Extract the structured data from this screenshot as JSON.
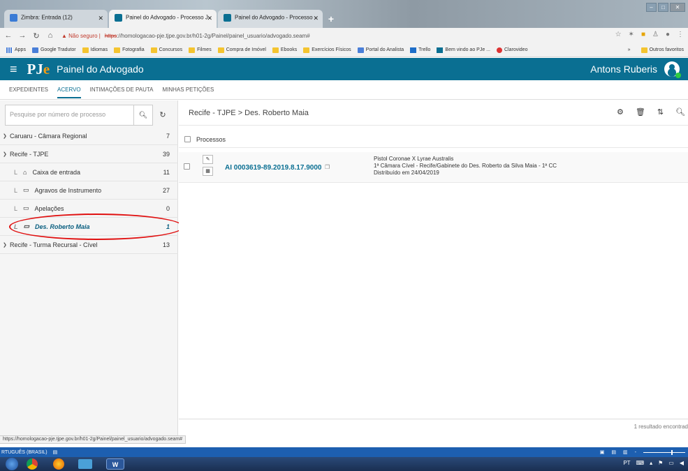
{
  "browser": {
    "tabs": [
      {
        "label": "Zimbra: Entrada (12)",
        "favicon_color": "#3a7bd5"
      },
      {
        "label": "Painel do Advogado - Processo J",
        "favicon_color": "#0a6f92"
      },
      {
        "label": "Painel do Advogado - Processo",
        "favicon_color": "#0a6f92"
      }
    ],
    "insecure_label": "Não seguro",
    "url_scheme": "https",
    "url_rest": "://homologacao-pje.tjpe.gov.br/h01-2g/Painel/painel_usuario/advogado.seam#",
    "bookmarks": [
      {
        "label": "Apps",
        "icon": "apps-icon"
      },
      {
        "label": "Google Tradutor",
        "icon": "translate-icon"
      },
      {
        "label": "Idiomas",
        "icon": "folder-icon"
      },
      {
        "label": "Fotografia",
        "icon": "folder-icon"
      },
      {
        "label": "Concursos",
        "icon": "folder-icon"
      },
      {
        "label": "Filmes",
        "icon": "folder-icon"
      },
      {
        "label": "Compra de Imóvel",
        "icon": "folder-icon"
      },
      {
        "label": "Ebooks",
        "icon": "folder-icon"
      },
      {
        "label": "Exercícios Físicos",
        "icon": "folder-icon"
      },
      {
        "label": "Portal do Analista",
        "icon": "portal-icon"
      },
      {
        "label": "Trello",
        "icon": "trello-icon"
      },
      {
        "label": "Bem vindo ao PJe ...",
        "icon": "pje-icon"
      },
      {
        "label": "Clarovideo",
        "icon": "clarovideo-icon"
      }
    ],
    "bookmarks_overflow": "»",
    "other_bookmarks": "Outros favoritos"
  },
  "header": {
    "logo_text_pj": "PJ",
    "logo_text_e": "e",
    "title": "Painel do Advogado",
    "user_name": "Antons Ruberis"
  },
  "subnav": {
    "tabs": [
      "EXPEDIENTES",
      "ACERVO",
      "INTIMAÇÕES DE PAUTA",
      "MINHAS PETIÇÕES"
    ],
    "active": "ACERVO"
  },
  "sidebar": {
    "search_placeholder": "Pesquise por número de processo",
    "tree": [
      {
        "label": "Caruaru - Câmara Regional",
        "count": "7",
        "level": 0,
        "expanded": false
      },
      {
        "label": "Recife - TJPE",
        "count": "39",
        "level": 0,
        "expanded": true
      },
      {
        "label": "Caixa de entrada",
        "count": "11",
        "level": 1,
        "icon": "home-icon"
      },
      {
        "label": "Agravos de Instrumento",
        "count": "27",
        "level": 1,
        "icon": "inbox-icon"
      },
      {
        "label": "Apelações",
        "count": "0",
        "level": 1,
        "icon": "inbox-icon"
      },
      {
        "label": "Des. Roberto Maia",
        "count": "1",
        "level": 1,
        "icon": "inbox-icon",
        "selected": true
      },
      {
        "label": "Recife - Turma Recursal - Cível",
        "count": "13",
        "level": 0,
        "expanded": false
      }
    ]
  },
  "main": {
    "breadcrumb": "Recife - TJPE > Des. Roberto Maia",
    "select_all_label": "Processos",
    "processes": [
      {
        "number": "AI 0003619-89.2019.8.17.9000",
        "parties": "Pistol Coronae X Lyrae Australis",
        "court": "1ª Câmara Cível - Recife/Gabinete do Des. Roberto da Silva Maia - 1ª CC",
        "distributed": "Distribuído em 24/04/2019"
      }
    ],
    "results_text": "1 resultado encontrad"
  },
  "statusbar": {
    "url": "https://homologacao-pje.tjpe.gov.br/h01-2g/Painel/painel_usuario/advogado.seam#"
  },
  "word_statusbar": {
    "language": "RTUGUÊS (BRASIL)"
  },
  "taskbar": {
    "tray_lang": "PT"
  },
  "colors": {
    "header_bg": "#0a6f92",
    "highlight": "#e01010",
    "link": "#0a6f92"
  }
}
